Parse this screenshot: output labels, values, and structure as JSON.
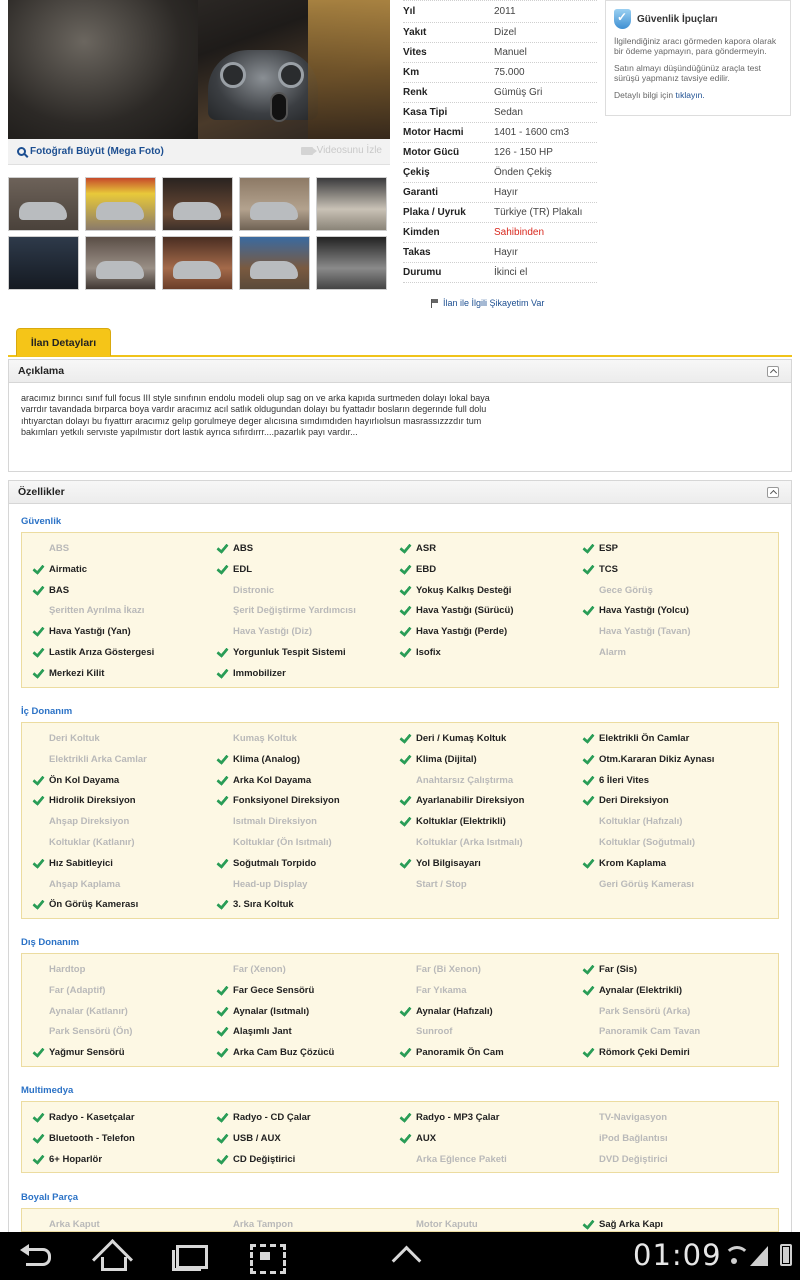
{
  "photo": {
    "enlarge_label": "Fotoğrafı Büyüt (Mega Foto)",
    "video_label": "Videosunu İzle",
    "thumbnail_count": 10
  },
  "info": [
    {
      "key": "Yıl",
      "value": "2011"
    },
    {
      "key": "Yakıt",
      "value": "Dizel"
    },
    {
      "key": "Vites",
      "value": "Manuel"
    },
    {
      "key": "Km",
      "value": "75.000"
    },
    {
      "key": "Renk",
      "value": "Gümüş Gri"
    },
    {
      "key": "Kasa Tipi",
      "value": "Sedan"
    },
    {
      "key": "Motor Hacmi",
      "value": "1401 - 1600 cm3"
    },
    {
      "key": "Motor Gücü",
      "value": "126 - 150 HP"
    },
    {
      "key": "Çekiş",
      "value": "Önden Çekiş"
    },
    {
      "key": "Garanti",
      "value": "Hayır"
    },
    {
      "key": "Plaka / Uyruk",
      "value": "Türkiye (TR) Plakalı"
    },
    {
      "key": "Kimden",
      "value": "Sahibinden"
    },
    {
      "key": "Takas",
      "value": "Hayır"
    },
    {
      "key": "Durumu",
      "value": "İkinci el"
    }
  ],
  "complaint_label": "İlan ile İlgili Şikayetim Var",
  "security": {
    "title": "Güvenlik İpuçları",
    "p1": "İlgilendiğiniz aracı görmeden kapora olarak bir ödeme yapmayın, para göndermeyin.",
    "p2": "Satın almayı düşündüğünüz araçla test sürüşü yapmanız tavsiye edilir.",
    "p3_prefix": "Detaylı bilgi için",
    "p3_link": "tıklayın."
  },
  "tab_label": "İlan Detayları",
  "description": {
    "title": "Açıklama",
    "text": "aracımız bırıncı sınıf full focus III style sınıfının endolu modeli olup sag on ve arka kapıda surtmeden dolayı lokal baya varrdır tavandada bırparca boya vardır aracımız acıl satlık oldugundan dolayı bu fyattadır bosların degerınde full dolu ıhtıyarctan dolayı bu fıyattırr aracımız gelıp gorulmeye deger alıcısına sımdımdıden hayırlıolsun masrassızzzdır tum bakımları yetkılı servıste yapılmıstır dort lastık ayrıca sıfırdırrr....pazarlık payı vardır..."
  },
  "features": {
    "title": "Özellikler",
    "groups": [
      {
        "name": "Güvenlik",
        "items": [
          {
            "label": "ABS",
            "on": false
          },
          {
            "label": "ABS",
            "on": true
          },
          {
            "label": "ASR",
            "on": true
          },
          {
            "label": "ESP",
            "on": true
          },
          {
            "label": "Airmatic",
            "on": true
          },
          {
            "label": "EDL",
            "on": true
          },
          {
            "label": "EBD",
            "on": true
          },
          {
            "label": "TCS",
            "on": true
          },
          {
            "label": "BAS",
            "on": true
          },
          {
            "label": "Distronic",
            "on": false
          },
          {
            "label": "Yokuş Kalkış Desteği",
            "on": true
          },
          {
            "label": "Gece Görüş",
            "on": false
          },
          {
            "label": "Şeritten Ayrılma İkazı",
            "on": false
          },
          {
            "label": "Şerit Değiştirme Yardımcısı",
            "on": false
          },
          {
            "label": "Hava Yastığı (Sürücü)",
            "on": true
          },
          {
            "label": "Hava Yastığı (Yolcu)",
            "on": true
          },
          {
            "label": "Hava Yastığı (Yan)",
            "on": true
          },
          {
            "label": "Hava Yastığı (Diz)",
            "on": false
          },
          {
            "label": "Hava Yastığı (Perde)",
            "on": true
          },
          {
            "label": "Hava Yastığı (Tavan)",
            "on": false
          },
          {
            "label": "Lastik Arıza Göstergesi",
            "on": true
          },
          {
            "label": "Yorgunluk Tespit Sistemi",
            "on": true
          },
          {
            "label": "Isofix",
            "on": true
          },
          {
            "label": "Alarm",
            "on": false
          },
          {
            "label": "Merkezi Kilit",
            "on": true
          },
          {
            "label": "Immobilizer",
            "on": true
          }
        ]
      },
      {
        "name": "İç Donanım",
        "items": [
          {
            "label": "Deri Koltuk",
            "on": false
          },
          {
            "label": "Kumaş Koltuk",
            "on": false
          },
          {
            "label": "Deri / Kumaş Koltuk",
            "on": true
          },
          {
            "label": "Elektrikli Ön Camlar",
            "on": true
          },
          {
            "label": "Elektrikli Arka Camlar",
            "on": false
          },
          {
            "label": "Klima (Analog)",
            "on": true
          },
          {
            "label": "Klima (Dijital)",
            "on": true
          },
          {
            "label": "Otm.Kararan Dikiz Aynası",
            "on": true
          },
          {
            "label": "Ön Kol Dayama",
            "on": true
          },
          {
            "label": "Arka Kol Dayama",
            "on": true
          },
          {
            "label": "Anahtarsız Çalıştırma",
            "on": false
          },
          {
            "label": "6 İleri Vites",
            "on": true
          },
          {
            "label": "Hidrolik Direksiyon",
            "on": true
          },
          {
            "label": "Fonksiyonel Direksiyon",
            "on": true
          },
          {
            "label": "Ayarlanabilir Direksiyon",
            "on": true
          },
          {
            "label": "Deri Direksiyon",
            "on": true
          },
          {
            "label": "Ahşap Direksiyon",
            "on": false
          },
          {
            "label": "Isıtmalı Direksiyon",
            "on": false
          },
          {
            "label": "Koltuklar (Elektrikli)",
            "on": true
          },
          {
            "label": "Koltuklar (Hafızalı)",
            "on": false
          },
          {
            "label": "Koltuklar (Katlanır)",
            "on": false
          },
          {
            "label": "Koltuklar (Ön Isıtmalı)",
            "on": false
          },
          {
            "label": "Koltuklar (Arka Isıtmalı)",
            "on": false
          },
          {
            "label": "Koltuklar (Soğutmalı)",
            "on": false
          },
          {
            "label": "Hız Sabitleyici",
            "on": true
          },
          {
            "label": "Soğutmalı Torpido",
            "on": true
          },
          {
            "label": "Yol Bilgisayarı",
            "on": true
          },
          {
            "label": "Krom Kaplama",
            "on": true
          },
          {
            "label": "Ahşap Kaplama",
            "on": false
          },
          {
            "label": "Head-up Display",
            "on": false
          },
          {
            "label": "Start / Stop",
            "on": false
          },
          {
            "label": "Geri Görüş Kamerası",
            "on": false
          },
          {
            "label": "Ön Görüş Kamerası",
            "on": true
          },
          {
            "label": "3. Sıra Koltuk",
            "on": true
          }
        ]
      },
      {
        "name": "Dış Donanım",
        "items": [
          {
            "label": "Hardtop",
            "on": false
          },
          {
            "label": "Far (Xenon)",
            "on": false
          },
          {
            "label": "Far (Bi Xenon)",
            "on": false
          },
          {
            "label": "Far (Sis)",
            "on": true
          },
          {
            "label": "Far (Adaptif)",
            "on": false
          },
          {
            "label": "Far Gece Sensörü",
            "on": true
          },
          {
            "label": "Far Yıkama",
            "on": false
          },
          {
            "label": "Aynalar (Elektrikli)",
            "on": true
          },
          {
            "label": "Aynalar (Katlanır)",
            "on": false
          },
          {
            "label": "Aynalar (Isıtmalı)",
            "on": true
          },
          {
            "label": "Aynalar (Hafızalı)",
            "on": true
          },
          {
            "label": "Park Sensörü (Arka)",
            "on": false
          },
          {
            "label": "Park Sensörü (Ön)",
            "on": false
          },
          {
            "label": "Alaşımlı Jant",
            "on": true
          },
          {
            "label": "Sunroof",
            "on": false
          },
          {
            "label": "Panoramik Cam Tavan",
            "on": false
          },
          {
            "label": "Yağmur Sensörü",
            "on": true
          },
          {
            "label": "Arka Cam Buz Çözücü",
            "on": true
          },
          {
            "label": "Panoramik Ön Cam",
            "on": true
          },
          {
            "label": "Römork Çeki Demiri",
            "on": true
          }
        ]
      },
      {
        "name": "Multimedya",
        "items": [
          {
            "label": "Radyo - Kasetçalar",
            "on": true
          },
          {
            "label": "Radyo - CD Çalar",
            "on": true
          },
          {
            "label": "Radyo - MP3 Çalar",
            "on": true
          },
          {
            "label": "TV-Navigasyon",
            "on": false
          },
          {
            "label": "Bluetooth - Telefon",
            "on": true
          },
          {
            "label": "USB / AUX",
            "on": true
          },
          {
            "label": "AUX",
            "on": true
          },
          {
            "label": "iPod Bağlantısı",
            "on": false
          },
          {
            "label": "6+ Hoparlör",
            "on": true
          },
          {
            "label": "CD Değiştirici",
            "on": true
          },
          {
            "label": "Arka Eğlence Paketi",
            "on": false
          },
          {
            "label": "DVD Değiştirici",
            "on": false
          }
        ]
      },
      {
        "name": "Boyalı Parça",
        "items": [
          {
            "label": "Arka Kaput",
            "on": false
          },
          {
            "label": "Arka Tampon",
            "on": false
          },
          {
            "label": "Motor Kaputu",
            "on": false
          },
          {
            "label": "Sağ Arka Kapı",
            "on": true
          }
        ]
      }
    ]
  },
  "statusbar": {
    "time": "01:09"
  }
}
